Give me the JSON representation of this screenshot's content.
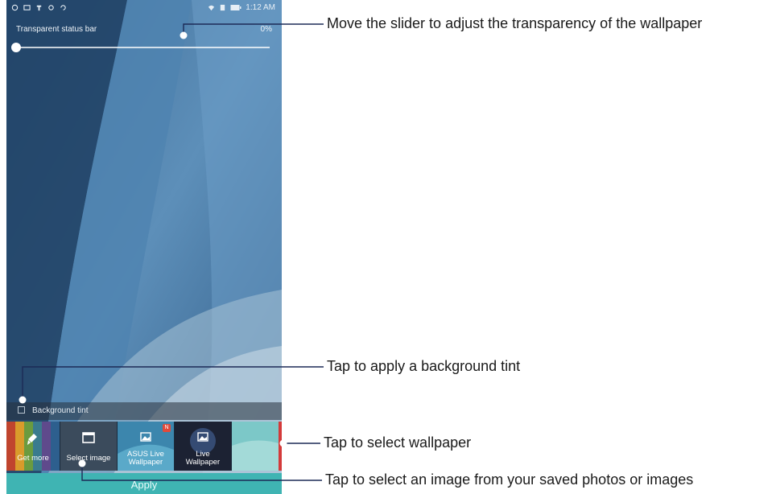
{
  "status_bar": {
    "time": "1:12 AM",
    "left_icons": [
      "notification-icon",
      "gallery-icon",
      "shirt-icon",
      "record-icon",
      "sync-icon"
    ],
    "right_icons": [
      "wifi-icon",
      "sim-icon",
      "battery-icon"
    ]
  },
  "transparency": {
    "label": "Transparent status bar",
    "value_text": "0%",
    "value": 0
  },
  "tint": {
    "label": "Background tint",
    "checked": false
  },
  "thumbnails": [
    {
      "label": "Get more",
      "icon": "brush-icon"
    },
    {
      "label": "Select image",
      "icon": "gallery-icon"
    },
    {
      "label": "ASUS Live\nWallpaper",
      "icon": "image-icon",
      "badge": "N"
    },
    {
      "label": "Live\nWallpaper",
      "icon": "image-icon"
    }
  ],
  "apply": {
    "label": "Apply"
  },
  "callouts": {
    "slider": "Move the slider to adjust the transparency of the wallpaper",
    "tint": "Tap to apply a background tint",
    "wallpaper": "Tap to select wallpaper",
    "select_image": "Tap to select an image from your saved photos or images"
  },
  "colors": {
    "apply_bar": "#3fb4b3",
    "callout_line": "#1c2a56"
  }
}
